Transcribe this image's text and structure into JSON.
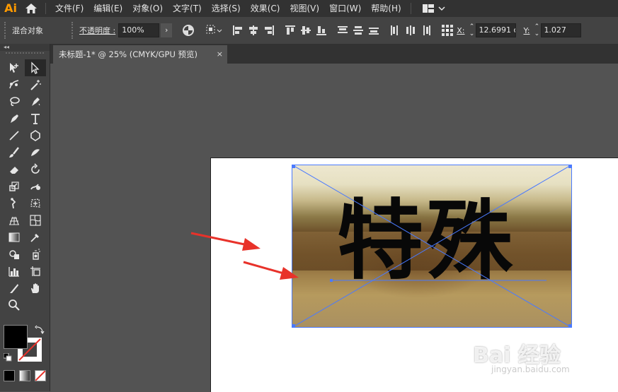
{
  "app": {
    "logo": "Ai"
  },
  "menu": [
    "文件(F)",
    "编辑(E)",
    "对象(O)",
    "文字(T)",
    "选择(S)",
    "效果(C)",
    "视图(V)",
    "窗口(W)",
    "帮助(H)"
  ],
  "control_bar": {
    "selection_label": "混合对象",
    "opacity_label": "不透明度",
    "opacity_colon": ":",
    "opacity_value": "100%",
    "opacity_arrow": "›",
    "x_label": "X:",
    "x_value": "12.6991 c",
    "y_label": "Y:",
    "y_value": "1.027"
  },
  "toolbar": {
    "collapse": "◂◂"
  },
  "document_tab": {
    "title": "未标题-1* @ 25% (CMYK/GPU 预览)",
    "close": "×"
  },
  "canvas": {
    "artwork_text": "特殊"
  },
  "watermark": {
    "brand": "Bai 经验",
    "url": "jingyan.baidu.com"
  },
  "colors": {
    "accent": "#4a7aff",
    "arrow": "#e8322a",
    "logo": "#ff9a00",
    "fill": "#000000",
    "stroke": "#ffffff"
  }
}
